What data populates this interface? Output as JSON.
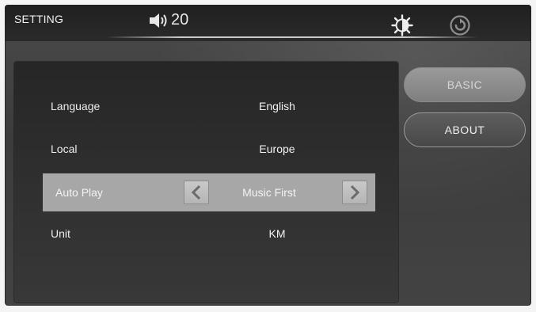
{
  "header": {
    "title": "SETTING",
    "volume_value": "20",
    "volume_icon": "speaker-icon",
    "brightness_icon": "brightness-icon",
    "back_icon": "back-icon"
  },
  "settings": {
    "rows": [
      {
        "label": "Language",
        "value": "English"
      },
      {
        "label": "Local",
        "value": "Europe"
      },
      {
        "label": "Auto Play",
        "value": "Music First",
        "selected": true
      },
      {
        "label": "Unit",
        "value": "KM"
      }
    ]
  },
  "sidebar": {
    "basic_label": "BASIC",
    "about_label": "ABOUT"
  }
}
